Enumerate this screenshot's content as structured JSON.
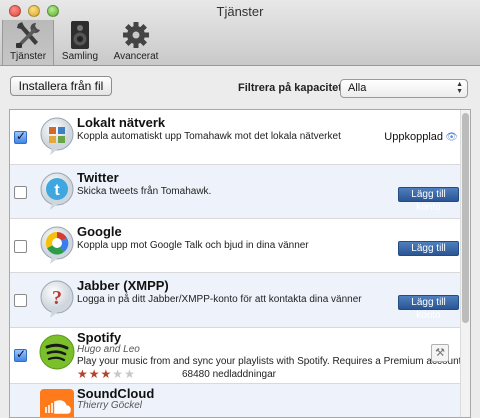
{
  "window": {
    "title": "Tjänster"
  },
  "toolbar": [
    {
      "label": "Tjänster",
      "icon": "tools-icon",
      "active": true
    },
    {
      "label": "Samling",
      "icon": "speaker-icon",
      "active": false
    },
    {
      "label": "Avancerat",
      "icon": "gear-icon",
      "active": false
    }
  ],
  "controls": {
    "install_label": "Installera från fil",
    "filter_label": "Filtrera på kapacitet:",
    "filter_value": "Alla"
  },
  "services": [
    {
      "name": "Lokalt nätverk",
      "description": "Koppla automatiskt upp Tomahawk mot det lokala nätverket",
      "checked": true,
      "status": "Uppkopplad",
      "icon": "local-network-icon"
    },
    {
      "name": "Twitter",
      "description": "Skicka tweets från Tomahawk.",
      "checked": false,
      "action": "Lägg till konto",
      "icon": "twitter-icon"
    },
    {
      "name": "Google",
      "description": "Koppla upp mot Google Talk och bjud in dina vänner",
      "checked": false,
      "action": "Lägg till konto",
      "icon": "google-icon"
    },
    {
      "name": "Jabber (XMPP)",
      "description": "Logga in på ditt Jabber/XMPP-konto för att kontakta dina vänner",
      "checked": false,
      "action": "Lägg till konto",
      "icon": "jabber-icon"
    },
    {
      "name": "Spotify",
      "author": "Hugo and Leo",
      "description": "Play your music from and sync your playlists with Spotify. Requires a Premium account.",
      "checked": true,
      "rating": 3,
      "rating_max": 5,
      "downloads": "68480 nedladdningar",
      "icon": "spotify-icon"
    },
    {
      "name": "SoundCloud",
      "author": "Thierry Göckel",
      "icon": "soundcloud-icon"
    }
  ]
}
